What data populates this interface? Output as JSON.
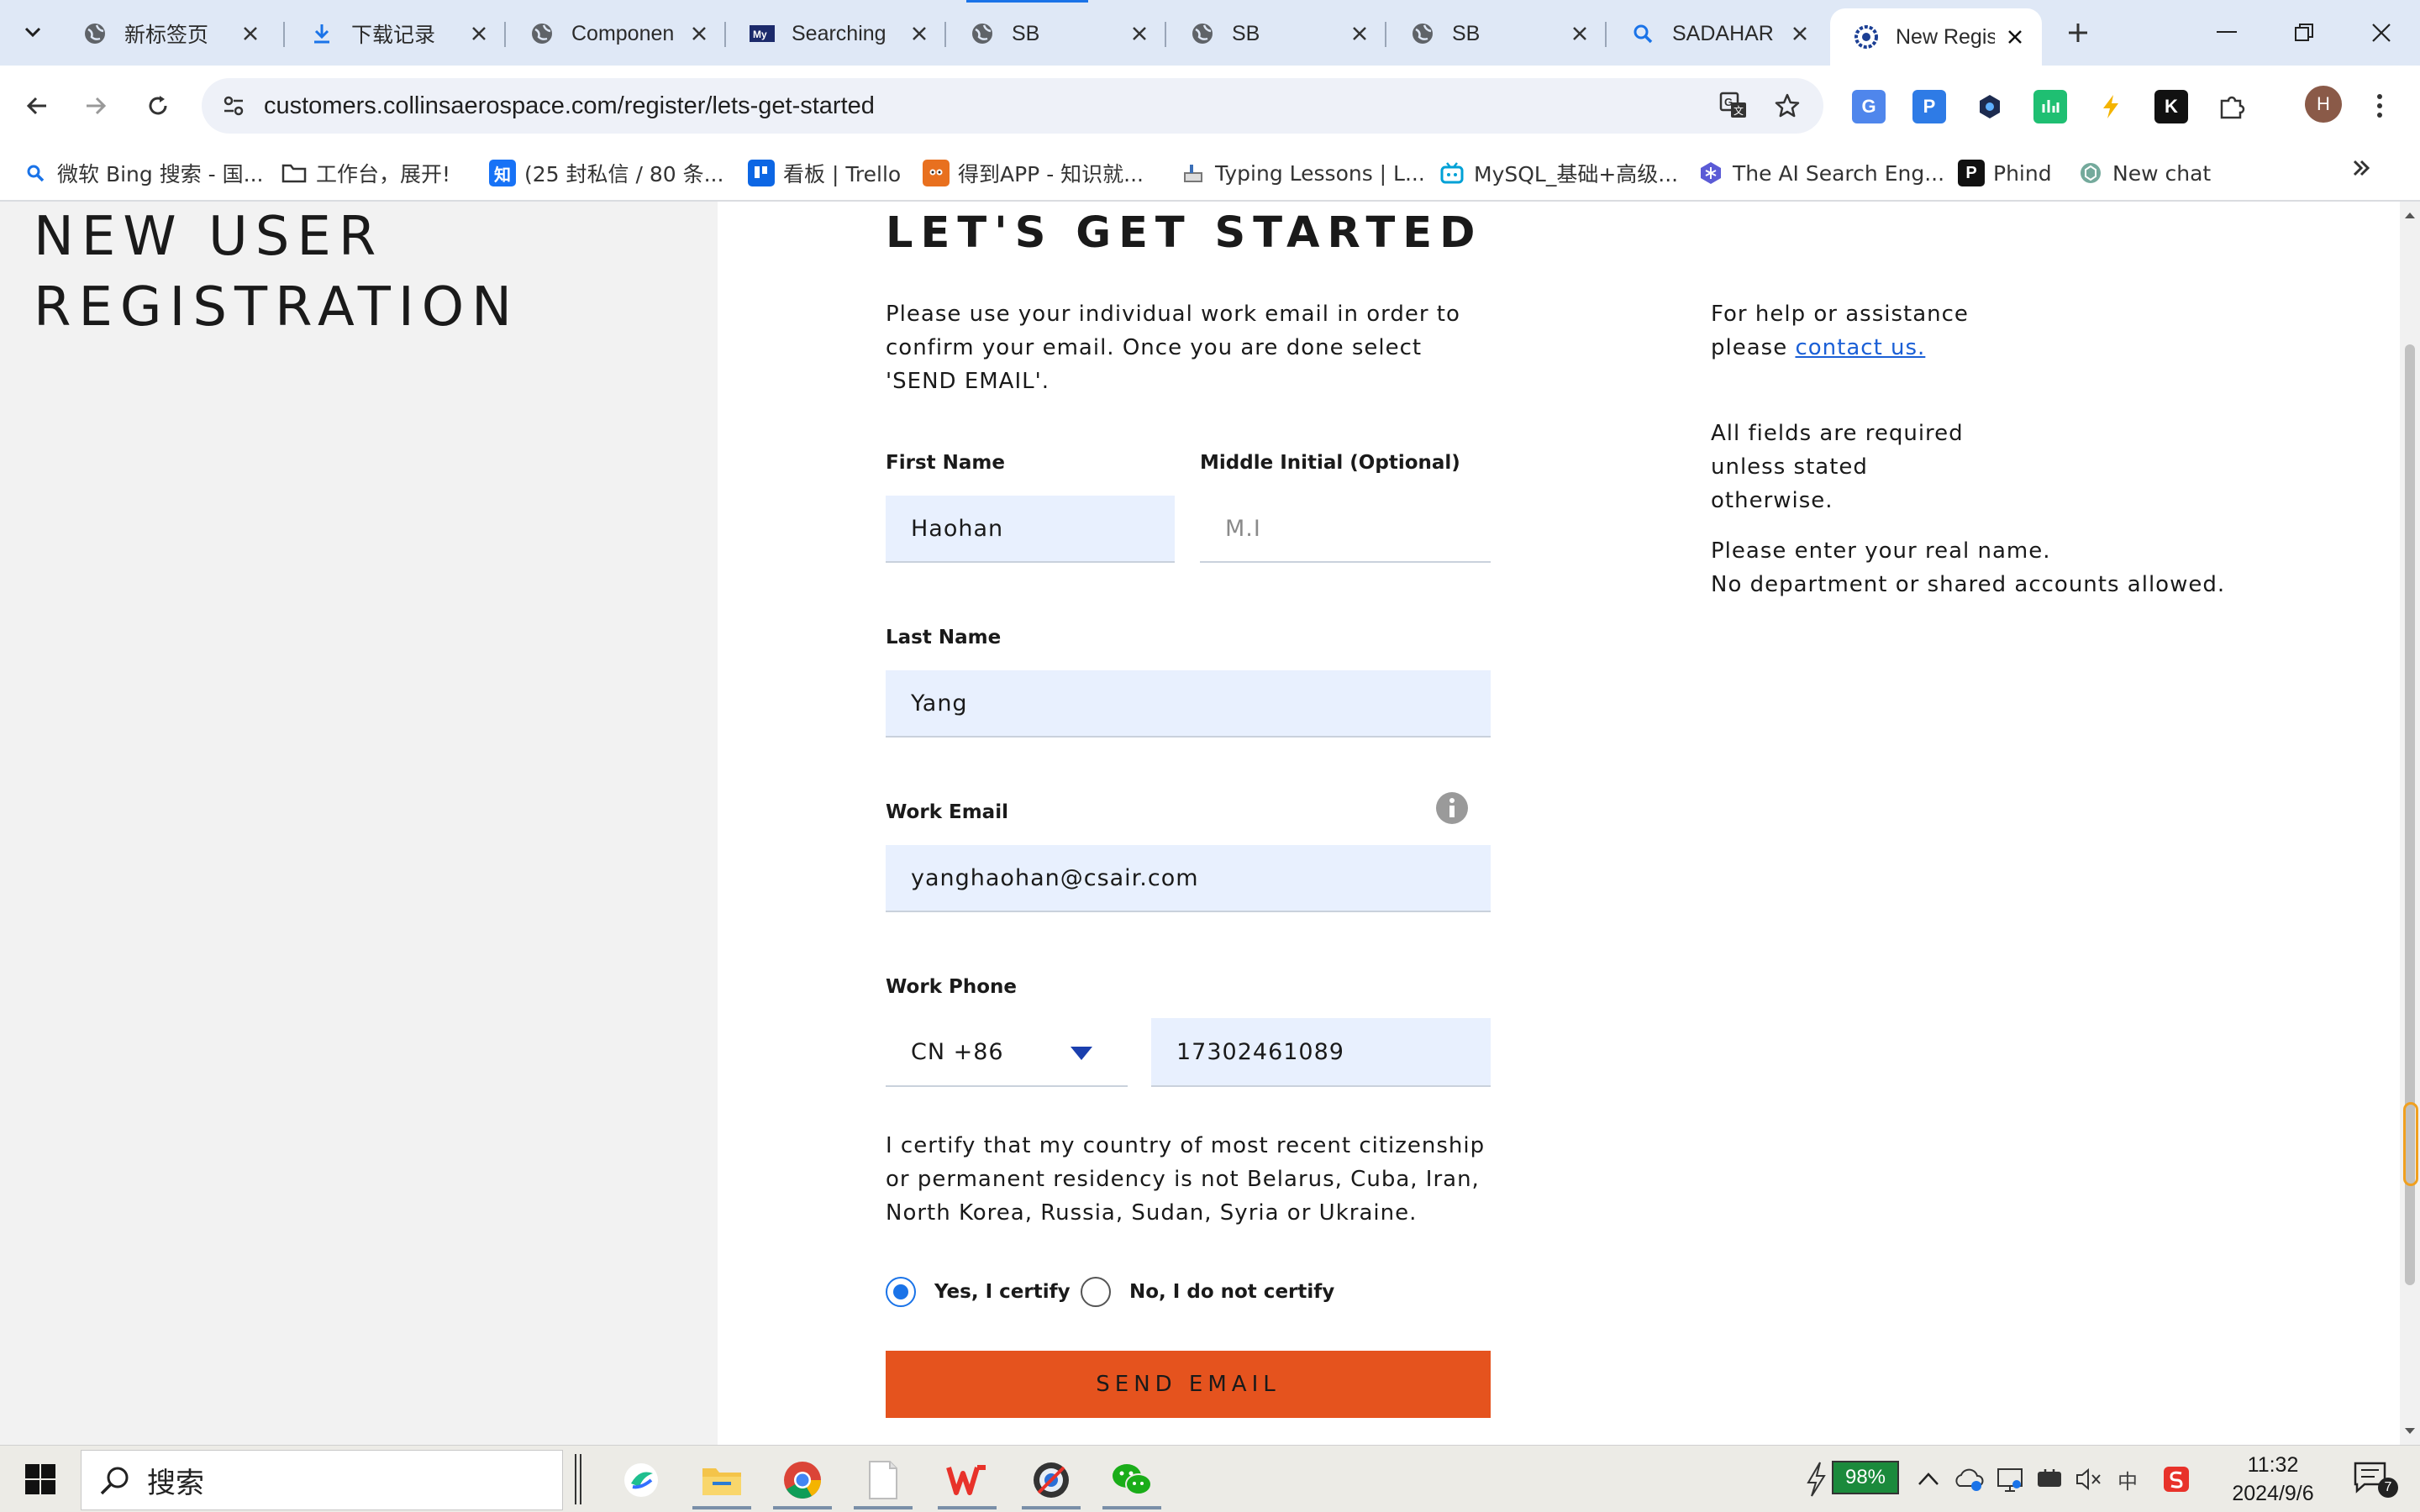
{
  "browser": {
    "tabs": [
      {
        "title": "新标签页",
        "icon": "globe-icon"
      },
      {
        "title": "下载记录",
        "icon": "download-icon"
      },
      {
        "title": "Componen",
        "icon": "globe-icon"
      },
      {
        "title": "Searching",
        "icon": "my-logo-icon"
      },
      {
        "title": "SB",
        "icon": "globe-icon"
      },
      {
        "title": "SB",
        "icon": "globe-icon"
      },
      {
        "title": "SB",
        "icon": "globe-icon"
      },
      {
        "title": "SADAHAR",
        "icon": "search-icon"
      },
      {
        "title": "New Regis",
        "icon": "collins-logo-icon",
        "active": true
      }
    ],
    "url": "customers.collinsaerospace.com/register/lets-get-started",
    "avatar_letter": "H",
    "bookmarks": [
      {
        "label": "微软 Bing 搜索 - 国...",
        "icon": "bing-search-icon"
      },
      {
        "label": "工作台，展开!",
        "icon": "folder-icon"
      },
      {
        "label": "(25 封私信 / 80 条...",
        "icon": "zhihu-icon"
      },
      {
        "label": "看板 | Trello",
        "icon": "trello-icon"
      },
      {
        "label": "得到APP - 知识就...",
        "icon": "dedao-icon"
      },
      {
        "label": "Typing Lessons | L...",
        "icon": "typing-icon"
      },
      {
        "label": "MySQL_基础+高级...",
        "icon": "bilibili-icon"
      },
      {
        "label": "The AI Search Eng...",
        "icon": "perplexity-icon"
      },
      {
        "label": "Phind",
        "icon": "phind-icon"
      },
      {
        "label": "New chat",
        "icon": "chatgpt-icon"
      }
    ],
    "extensions": [
      "translate-ext-icon",
      "paste-ext-icon",
      "hex-ext-icon",
      "chart-ext-icon",
      "bolt-ext-icon",
      "k-ext-icon",
      "puzzle-icon"
    ]
  },
  "page": {
    "left_title": "NEW USER REGISTRATION",
    "heading": "LET'S GET STARTED",
    "intro": "Please use your individual work email in order to confirm your email. Once you are done select 'SEND EMAIL'.",
    "help": {
      "line1": "For help or assistance",
      "please": "please ",
      "contact_link": "contact us.",
      "required": "All fields are required unless stated otherwise.",
      "real_name_1": "Please enter your real name.",
      "real_name_2": "No department or shared accounts allowed."
    },
    "form": {
      "first_name": {
        "label": "First Name",
        "value": "Haohan"
      },
      "middle_initial": {
        "label": "Middle Initial (Optional)",
        "placeholder": "M.I"
      },
      "last_name": {
        "label": "Last Name",
        "value": "Yang"
      },
      "work_email": {
        "label": "Work Email",
        "value": "yanghaohan@csair.com"
      },
      "work_phone": {
        "label": "Work Phone",
        "country_code": "CN +86",
        "number": "17302461089"
      },
      "certify_text": "I certify that my country of most recent citizenship or permanent residency is not Belarus, Cuba, Iran, North Korea, Russia, Sudan, Syria or Ukraine.",
      "radio_yes": "Yes, I certify",
      "radio_no": "No, I do not certify",
      "selected": "yes",
      "submit_label": "SEND EMAIL"
    },
    "colors": {
      "accent": "#e5531e",
      "field_bg": "#e8f0fe",
      "link": "#1a5fd6",
      "radio": "#1a73e8"
    }
  },
  "taskbar": {
    "search_placeholder": "搜索",
    "battery": "98%",
    "time": "11:32",
    "date": "2024/9/6",
    "ime": "中",
    "notifications": "7",
    "apps": [
      "feishu-icon",
      "file-explorer-icon",
      "chrome-icon",
      "notepad-icon",
      "wps-icon",
      "browser-icon",
      "wechat-icon"
    ]
  }
}
